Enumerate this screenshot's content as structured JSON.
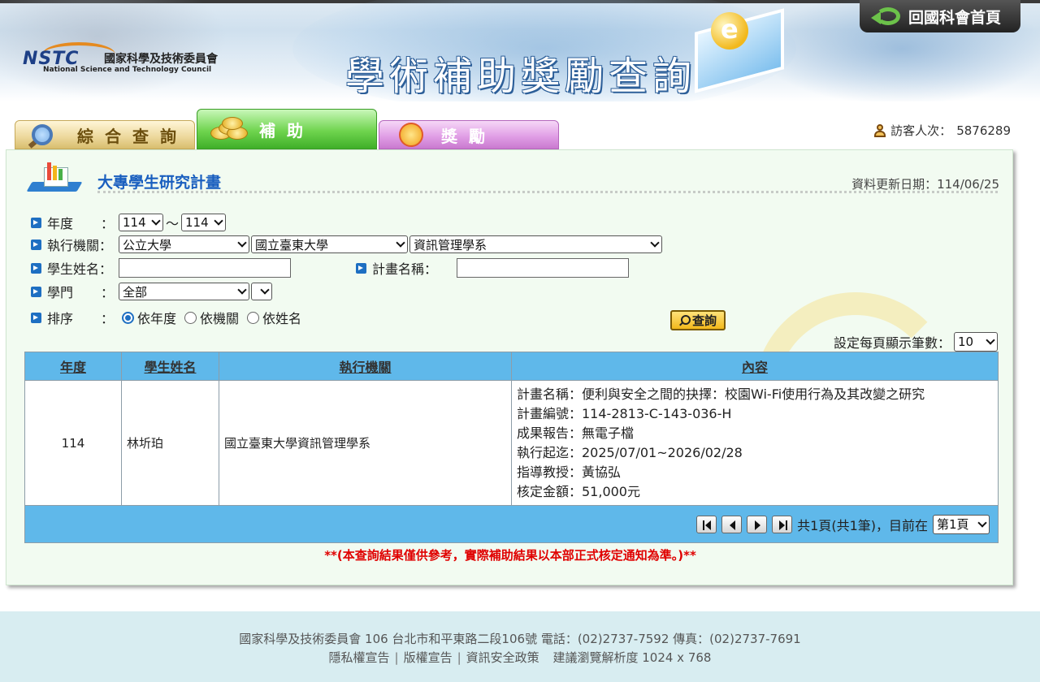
{
  "header": {
    "logo_abbr": "NSTC",
    "logo_cn": "國家科學及技術委員會",
    "logo_en": "National Science and Technology Council",
    "title": "學術補助獎勵查詢",
    "home_button": "回國科會首頁"
  },
  "tabs": [
    {
      "label": "綜合查詢",
      "icon": "magnifier-icon",
      "active": false
    },
    {
      "label": "補助",
      "icon": "coins-icon",
      "active": true
    },
    {
      "label": "獎勵",
      "icon": "medal-icon",
      "active": false
    }
  ],
  "visitor": {
    "label": "訪客人次：",
    "count": "5876289"
  },
  "section": {
    "title": "大專學生研究計畫",
    "update_label": "資料更新日期：",
    "update_date": "114/06/25"
  },
  "form": {
    "year_label": "年度",
    "colon": "：",
    "year_from": "114",
    "year_sep": "～",
    "year_to": "114",
    "org_label": "執行機關：",
    "org_type": "公立大學",
    "org_school": "國立臺東大學",
    "org_dept": "資訊管理學系",
    "student_label": "學生姓名：",
    "student_value": "",
    "plan_label": "計畫名稱：",
    "plan_value": "",
    "field_label": "學門",
    "field_value": "全部",
    "field_sub": "",
    "sort_label": "排序",
    "sort_options": [
      "依年度",
      "依機關",
      "依姓名"
    ],
    "sort_selected": 0,
    "query_button": "查詢"
  },
  "perpage": {
    "label": "設定每頁顯示筆數：",
    "value": "10"
  },
  "table": {
    "headers": [
      "年度",
      "學生姓名",
      "執行機關",
      "內容"
    ],
    "rows": [
      {
        "year": "114",
        "student": "林圻珀",
        "org": "國立臺東大學資訊管理學系",
        "content": [
          "計畫名稱：便利與安全之間的抉擇：校園Wi-Fi使用行為及其改變之研究",
          "計畫編號：114-2813-C-143-036-H",
          "成果報告：無電子檔",
          "執行起迄：2025/07/01~2026/02/28",
          "指導教授：黃協弘",
          "核定金額：51,000元"
        ]
      }
    ]
  },
  "pager": {
    "summary": "共1頁(共1筆)，目前在",
    "current": "第1頁"
  },
  "notice": "**(本查詢結果僅供參考，實際補助結果以本部正式核定通知為準。)**",
  "footer": {
    "address": "國家科學及技術委員會  106  台北市和平東路二段106號  電話：(02)2737-7592  傳真：(02)2737-7691",
    "links": [
      "隱私權宣告",
      "版權宣告",
      "資訊安全政策"
    ],
    "resolution": "建議瀏覽解析度 1024 x 768",
    "link_sep": "|"
  }
}
